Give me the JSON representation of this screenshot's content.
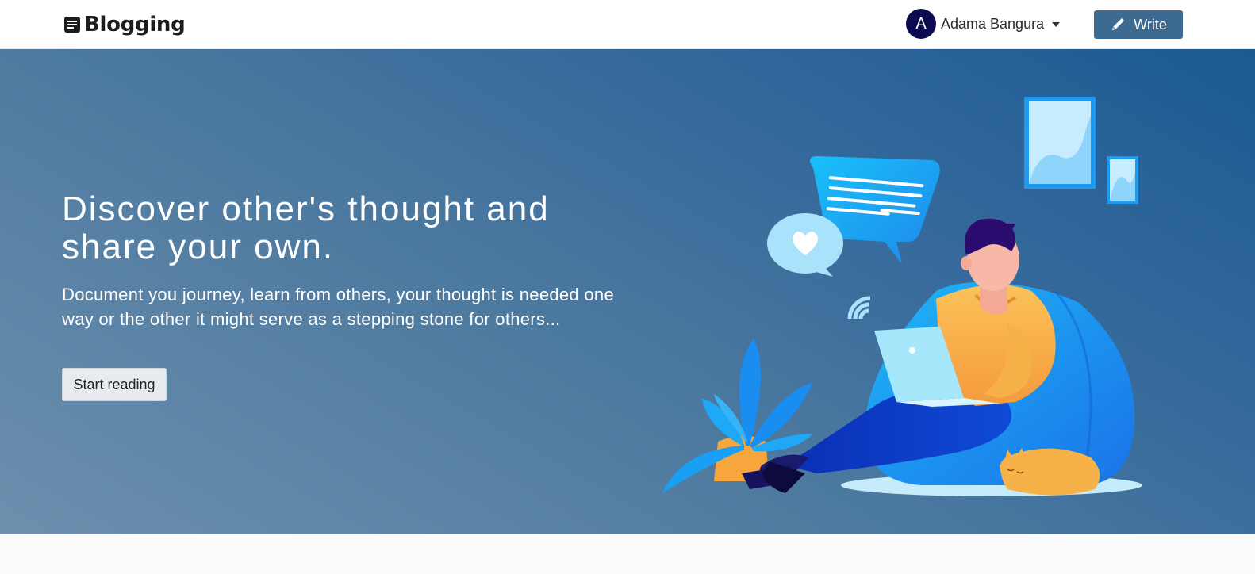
{
  "navbar": {
    "brand": "Blogging",
    "brand_icon": "document-icon",
    "user": {
      "initial": "A",
      "name": "Adama Bangura"
    },
    "write_label": "Write",
    "write_icon": "pen-icon"
  },
  "hero": {
    "title": "Discover other's thought and share your own.",
    "text": "Document you journey, learn from others, your thought is needed one way or the other it might serve as a stepping stone for others...",
    "button_label": "Start reading"
  },
  "colors": {
    "avatar": "#0d0b4f",
    "write_button": "#3d6a91",
    "hero_gradient": [
      "#6d90ae",
      "#1b5a93"
    ]
  }
}
